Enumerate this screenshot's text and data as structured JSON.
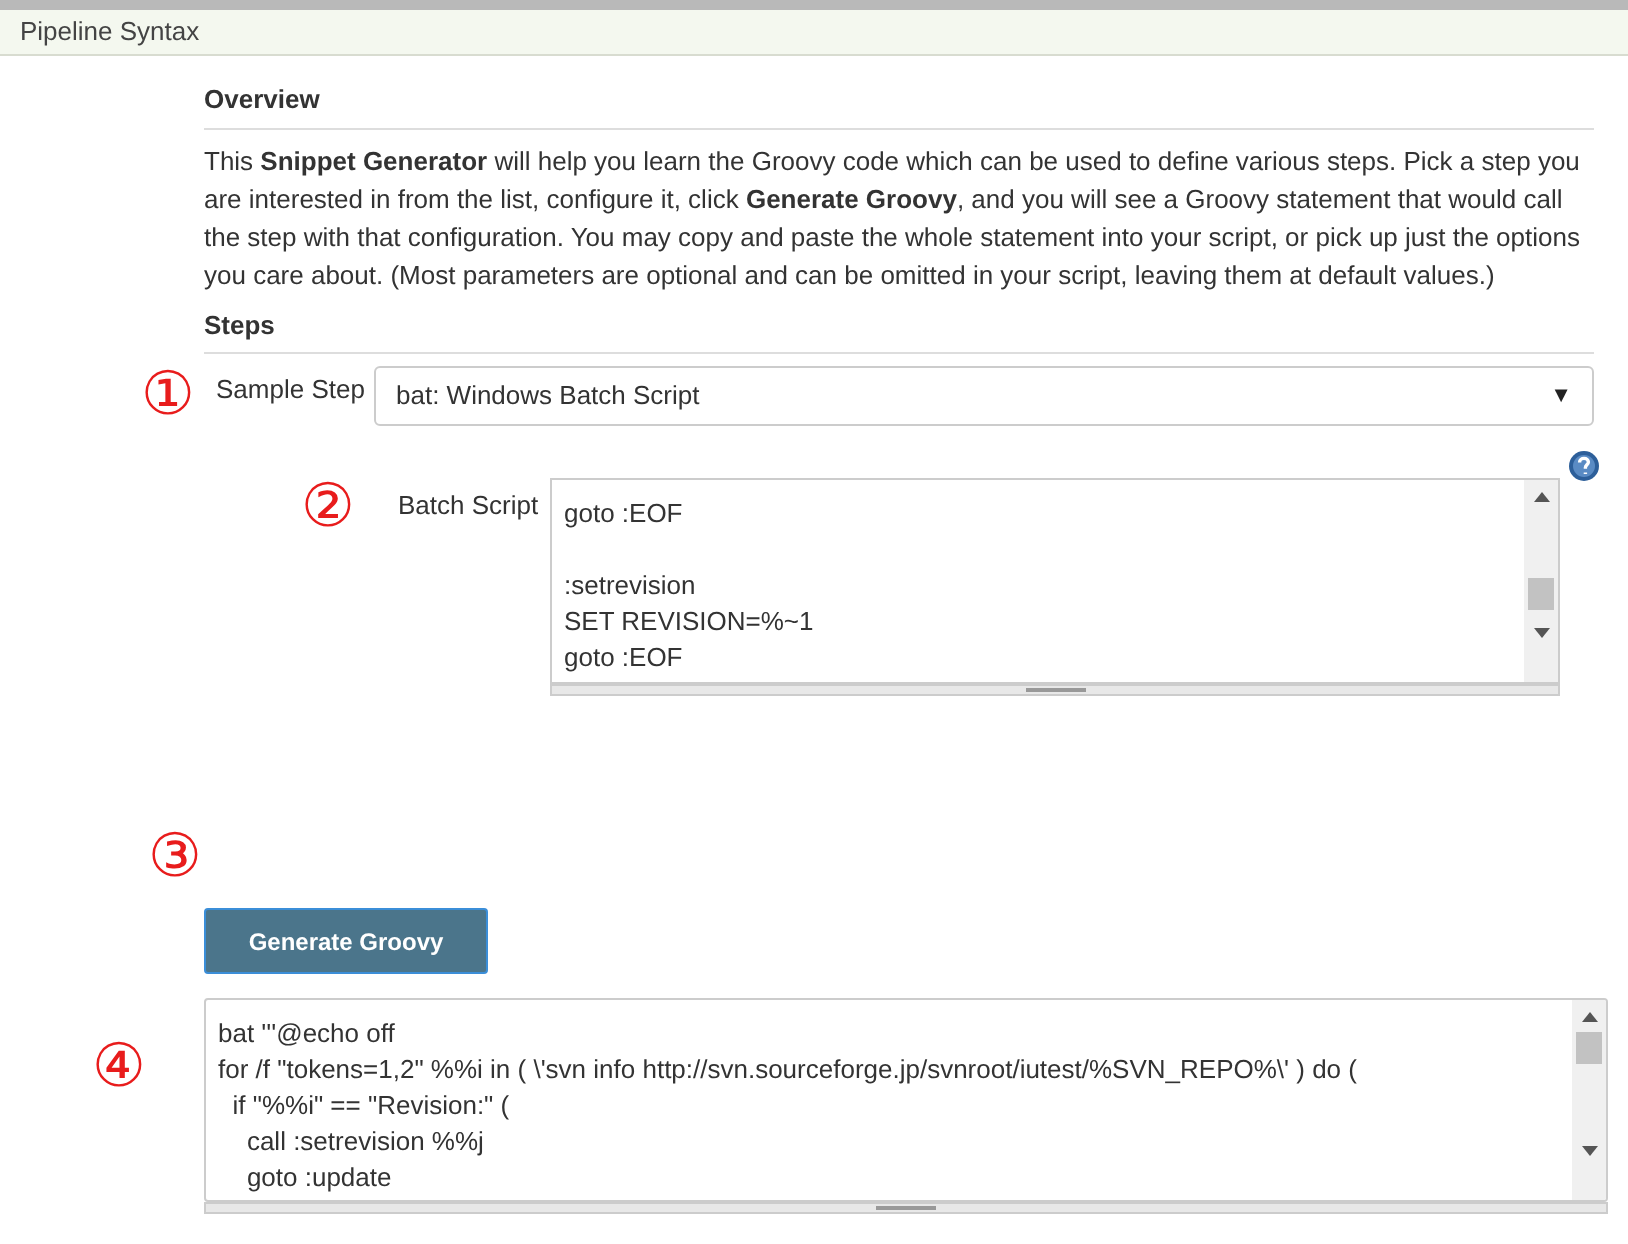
{
  "header": {
    "title": "Pipeline Syntax"
  },
  "overview": {
    "heading": "Overview",
    "text": "This **Snippet Generator** will help you learn the Groovy code which can be used to define various steps. Pick a step you are interested in from the list, configure it, click **Generate Groovy**, and you will see a Groovy statement that would call the step with that configuration. You may copy and paste the whole statement into your script, or pick up just the options you care about. (Most parameters are optional and can be omitted in your script, leaving them at default values.)"
  },
  "steps": {
    "heading": "Steps",
    "marker": "①",
    "label": "Sample Step",
    "value": "bat: Windows Batch Script",
    "caret": "▼"
  },
  "batch_script": {
    "marker": "②",
    "label": "Batch Script",
    "text": "goto :EOF\n\n:setrevision\nSET REVISION=%~1\ngoto :EOF"
  },
  "generate": {
    "marker": "③",
    "label": "Generate Groovy"
  },
  "output": {
    "marker": "④",
    "lines": [
      "bat '''@echo off",
      "for /f \"tokens=1,2\" %%i in ( \\'svn info http://svn.sourceforge.jp/svnroot/iutest/%SVN_REPO%\\' ) do (",
      "  if \"%%i\" == \"Revision:\" (",
      "    call :setrevision %%j",
      "    goto :update"
    ]
  }
}
